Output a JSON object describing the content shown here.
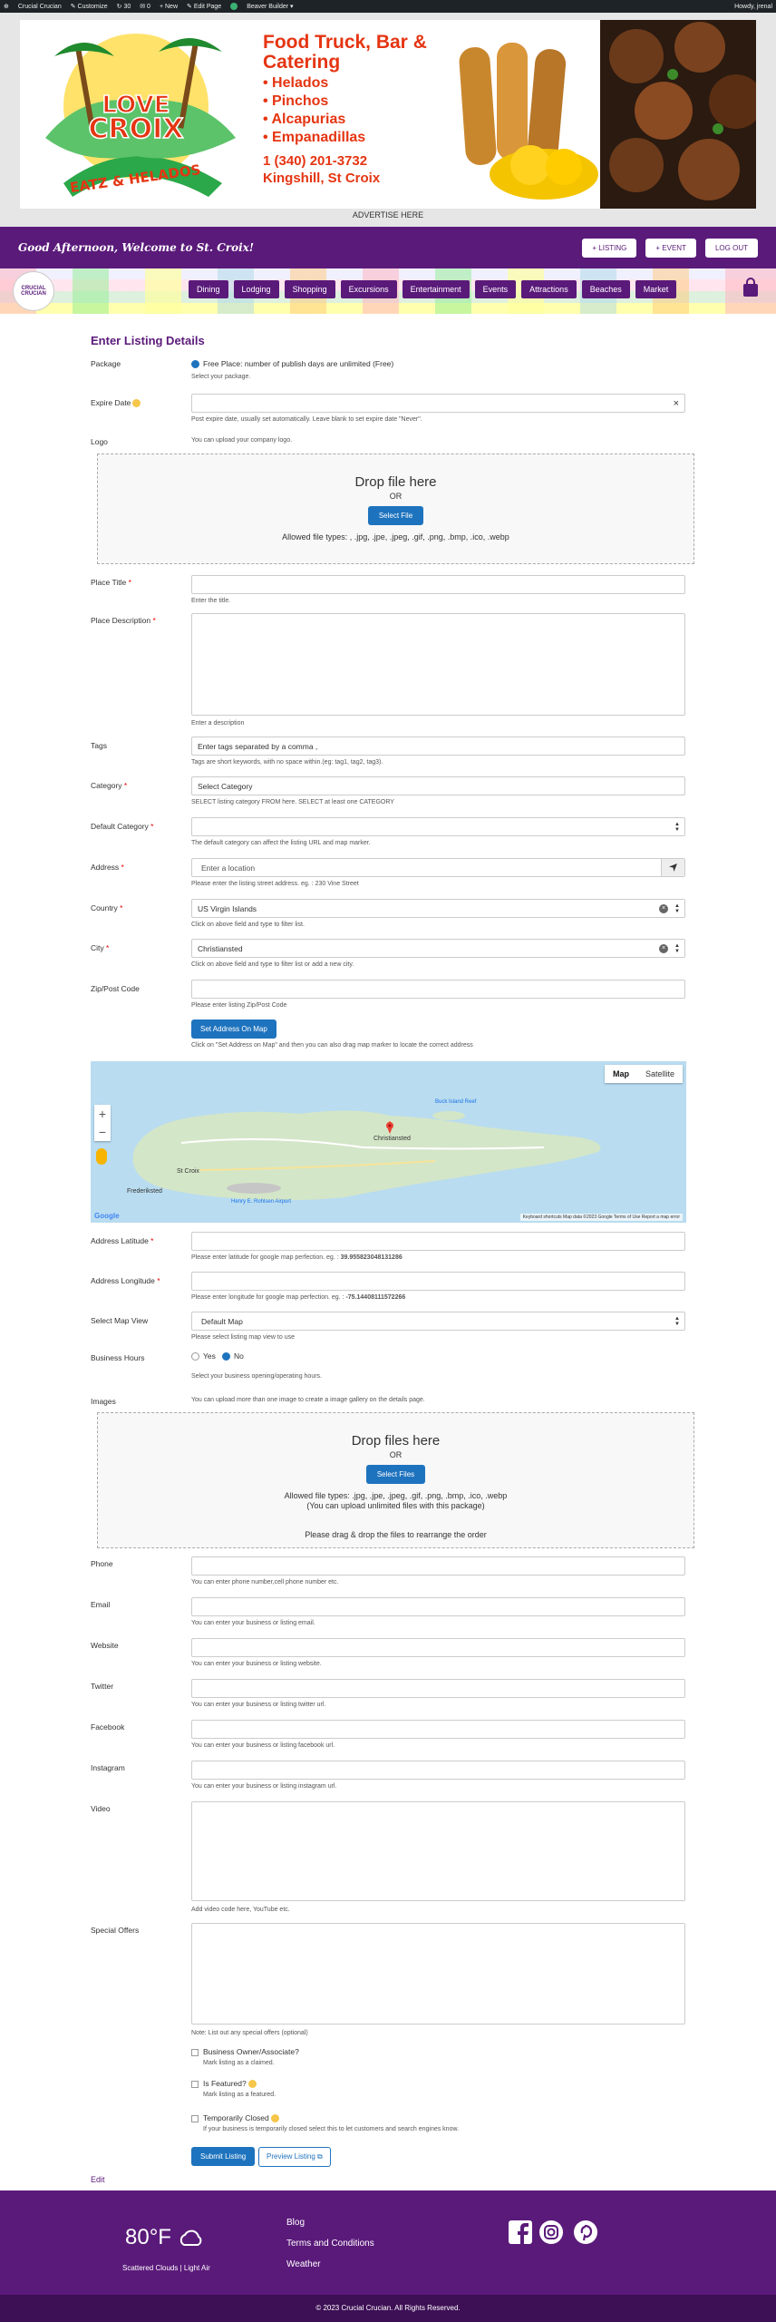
{
  "admin_bar": {
    "site_name": "Crucial Crucian",
    "customize": "Customize",
    "updates": "30",
    "comments": "0",
    "new": "New",
    "edit_page": "Edit Page",
    "builder": "Beaver Builder",
    "howdy": "Howdy, jrenal"
  },
  "banner": {
    "logo_line1": "LOVE",
    "logo_line2": "CROIX",
    "logo_line3": "EATZ & HELADOS",
    "title": "Food Truck, Bar & Catering",
    "items": [
      "• Helados",
      "• Pinchos",
      "• Alcapurias",
      "• Empanadillas"
    ],
    "phone": "1 (340) 201-3732",
    "location": "Kingshill, St Croix",
    "advertise": "ADVERTISE HERE"
  },
  "header": {
    "welcome": "Good Afternoon, Welcome to St. Croix!",
    "buttons": [
      "+ LISTING",
      "+ EVENT",
      "LOG OUT"
    ],
    "logo_text": "CRUCIAL CRUCIAN"
  },
  "nav": {
    "items": [
      "Dining",
      "Lodging",
      "Shopping",
      "Excursions",
      "Entertainment",
      "Events",
      "Attractions",
      "Beaches",
      "Market"
    ]
  },
  "form": {
    "title": "Enter Listing Details",
    "package": {
      "label": "Package",
      "option": "Free Place: number of publish days are unlimited (Free)",
      "hint": "Select your package."
    },
    "expire": {
      "label": "Expire Date",
      "value": "",
      "clear": "×",
      "hint": "Post expire date, usually set automatically. Leave blank to set expire date \"Never\"."
    },
    "logo": {
      "label": "Logo",
      "hint": "You can upload your company logo.",
      "drop": "Drop file here",
      "or": "OR",
      "button": "Select File",
      "types": "Allowed file types: , .jpg, .jpe, .jpeg, .gif, .png, .bmp, .ico, .webp"
    },
    "title_field": {
      "label": "Place Title",
      "hint": "Enter the title."
    },
    "description": {
      "label": "Place Description",
      "hint": "Enter a description"
    },
    "tags": {
      "label": "Tags",
      "placeholder": "Enter tags separated by a comma ,",
      "hint": "Tags are short keywords, with no space within.(eg: tag1, tag2, tag3)."
    },
    "category": {
      "label": "Category",
      "placeholder": "Select Category",
      "hint": "SELECT listing category FROM here. SELECT at least one CATEGORY"
    },
    "default_category": {
      "label": "Default Category",
      "hint": "The default category can affect the listing URL and map marker."
    },
    "address": {
      "label": "Address",
      "placeholder": "Enter a location",
      "hint": "Please enter the listing street address. eg. : 230 Vine Street"
    },
    "country": {
      "label": "Country",
      "value": "US Virgin Islands",
      "hint": "Click on above field and type to filter list."
    },
    "city": {
      "label": "City",
      "value": "Christiansted",
      "hint": "Click on above field and type to filter list or add a new city."
    },
    "zip": {
      "label": "Zip/Post Code",
      "hint": "Please enter listing Zip/Post Code"
    },
    "set_address": {
      "button": "Set Address On Map",
      "hint": "Click on \"Set Address on Map\" and then you can also drag map marker to locate the correct address"
    },
    "map": {
      "map_label": "Map",
      "satellite_label": "Satellite",
      "zoom_in": "+",
      "zoom_out": "−",
      "place_christiansted": "Christiansted",
      "place_st_croix": "St Croix",
      "place_frederiksted": "Frederiksted",
      "place_buck_island": "Buck Island Reef",
      "place_henry_e": "Henry E. Rohlsen Airport",
      "footer": "Keyboard shortcuts   Map data ©2023 Google   Terms of Use   Report a map error",
      "google": "Google"
    },
    "latitude": {
      "label": "Address Latitude",
      "hint": "Please enter latitude for google map perfection. eg. : ",
      "example": "39.955823048131286"
    },
    "longitude": {
      "label": "Address Longitude",
      "hint": "Please enter longitude for google map perfection. eg. : ",
      "example": "-75.14408111572266"
    },
    "map_view": {
      "label": "Select Map View",
      "value": "Default Map",
      "hint": "Please select listing map view to use"
    },
    "hours": {
      "label": "Business Hours",
      "yes": "Yes",
      "no": "No",
      "hint": "Select your business opening/operating hours."
    },
    "images": {
      "label": "Images",
      "hint": "You can upload more than one image to create a image gallery on the details page.",
      "drop": "Drop files here",
      "or": "OR",
      "button": "Select Files",
      "types": "Allowed file types: .jpg, .jpe, .jpeg, .gif, .png, .bmp, .ico, .webp",
      "limit": "(You can upload unlimited files with this package)",
      "drag": "Please drag & drop the files to rearrange the order"
    },
    "phone": {
      "label": "Phone",
      "hint": "You can enter phone number,cell phone number etc."
    },
    "email": {
      "label": "Email",
      "hint": "You can enter your business or listing email."
    },
    "website": {
      "label": "Website",
      "hint": "You can enter your business or listing website."
    },
    "twitter": {
      "label": "Twitter",
      "hint": "You can enter your business or listing twitter url."
    },
    "facebook": {
      "label": "Facebook",
      "hint": "You can enter your business or listing facebook url."
    },
    "instagram": {
      "label": "Instagram",
      "hint": "You can enter your business or listing instagram url."
    },
    "video": {
      "label": "Video",
      "hint": "Add video code here, YouTube etc."
    },
    "offers": {
      "label": "Special Offers",
      "hint": "Note: List out any special offers (optional)"
    },
    "owner": {
      "label": "Business Owner/Associate?",
      "hint": "Mark listing as a claimed."
    },
    "featured": {
      "label": "Is Featured?",
      "hint": "Mark listing as a featured."
    },
    "closed": {
      "label": "Temporarily Closed",
      "hint": "If your business is temporarily closed select this to let customers and search engines know."
    },
    "submit": "Submit Listing",
    "preview": "Preview Listing",
    "edit": "Edit"
  },
  "footer": {
    "temp": "80°F",
    "weather": "Scattered Clouds | Light Air",
    "links": [
      "Blog",
      "Terms and Conditions",
      "Weather"
    ],
    "copyright": "© 2023 Crucial Crucian. All Rights Reserved."
  },
  "colors": {
    "brand_purple": "#5a1a7a",
    "button_blue": "#1e73be",
    "banner_red": "#e53512"
  }
}
